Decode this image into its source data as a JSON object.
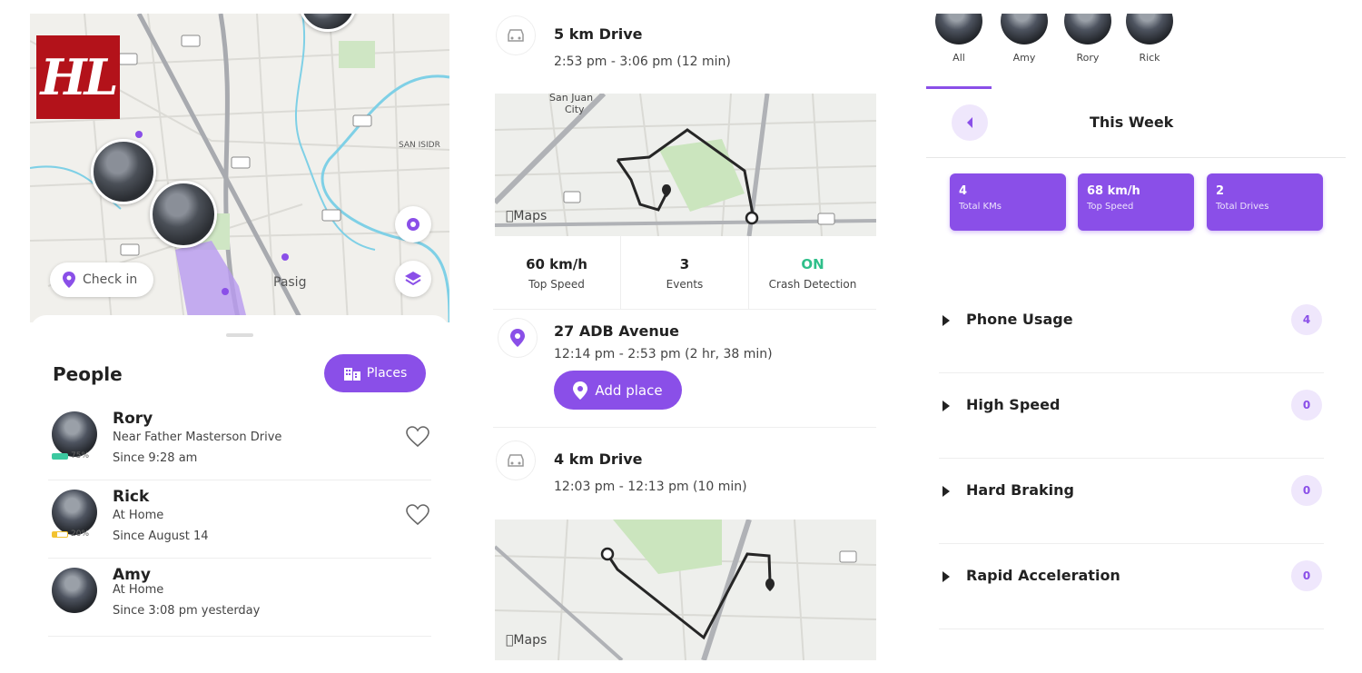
{
  "logo": {
    "text": "HL"
  },
  "people_panel": {
    "map_place_label": "Pasig",
    "map_place_label_2": "SAN ISIDR",
    "checkin_label": "Check in",
    "title": "People",
    "places_label": "Places",
    "people": [
      {
        "name": "Rory",
        "location": "Near Father Masterson Drive",
        "since": "Since 9:28 am",
        "battery": "75%",
        "battery_color": "#3cc9a0"
      },
      {
        "name": "Rick",
        "location": "At Home",
        "since": "Since August 14",
        "battery": "20%",
        "battery_color": "#f2c230"
      },
      {
        "name": "Amy",
        "location": "At Home",
        "since": "Since 3:08 pm yesterday",
        "battery": "",
        "battery_color": ""
      }
    ]
  },
  "drive_panel": {
    "drive1": {
      "title": "5 km Drive",
      "time": "2:53 pm - 3:06 pm (12 min)"
    },
    "map1": {
      "city_label_1": "San Juan",
      "city_label_2": "City",
      "brand": "Maps"
    },
    "stats": [
      {
        "value": "60 km/h",
        "label": "Top Speed"
      },
      {
        "value": "3",
        "label": "Events"
      },
      {
        "value": "ON",
        "label": "Crash Detection"
      }
    ],
    "place": {
      "title": "27 ADB Avenue",
      "time": "12:14 pm - 2:53 pm (2 hr, 38 min)",
      "add_label": "Add place"
    },
    "drive2": {
      "title": "4 km Drive",
      "time": "12:03 pm - 12:13 pm (10 min)"
    },
    "map2": {
      "brand": "Maps"
    }
  },
  "report_panel": {
    "tabs": [
      "All",
      "Amy",
      "Rory",
      "Rick"
    ],
    "week_title": "This Week",
    "cards": [
      {
        "value": "4",
        "label": "Total KMs"
      },
      {
        "value": "68 km/h",
        "label": "Top Speed"
      },
      {
        "value": "2",
        "label": "Total Drives"
      }
    ],
    "events": [
      {
        "title": "Phone Usage",
        "count": "4"
      },
      {
        "title": "High Speed",
        "count": "0"
      },
      {
        "title": "Hard Braking",
        "count": "0"
      },
      {
        "title": "Rapid Acceleration",
        "count": "0"
      }
    ]
  },
  "colors": {
    "accent": "#8a4fe8",
    "accent_light": "#efe7fc",
    "crash_on": "#2fbf8a",
    "logo": "#b3121a"
  }
}
